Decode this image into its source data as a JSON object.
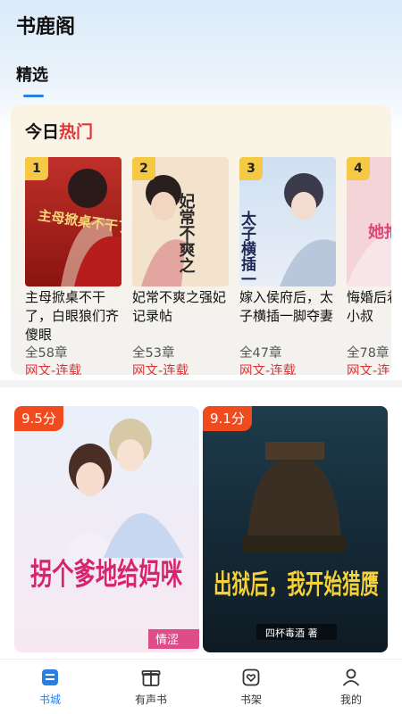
{
  "app": {
    "title": "书鹿阁"
  },
  "tabs": [
    {
      "label": "精选",
      "active": true
    }
  ],
  "hot": {
    "title_part1": "今日",
    "title_part2": "热门",
    "books": [
      {
        "rank": "1",
        "title": "主母掀桌不干了，白眼狼们齐傻眼",
        "chapters": "全58章",
        "category": "网文-连载",
        "cover_text": "主母掀桌不干了"
      },
      {
        "rank": "2",
        "title": "妃常不爽之强妃记录帖",
        "chapters": "全53章",
        "category": "网文-连载",
        "cover_text": "妃常不爽之"
      },
      {
        "rank": "3",
        "title": "嫁入侯府后，太子横插一脚夺妻",
        "chapters": "全47章",
        "category": "网文-连载",
        "cover_text": "太子横插一脚夺妻"
      },
      {
        "rank": "4",
        "title": "悔婚后着孕肚男小叔",
        "chapters": "全78章",
        "category": "网文-连载",
        "cover_text": "她抱渣男"
      }
    ]
  },
  "featured": [
    {
      "score": "9.5分",
      "cover_text": "拐个爹地给妈咪",
      "author_mark": "情涩"
    },
    {
      "score": "9.1分",
      "cover_text": "出狱后，我开始猎赝",
      "author_mark": "四杯毒酒 著"
    }
  ],
  "nav": [
    {
      "label": "书城",
      "icon": "bookstore-icon",
      "active": true
    },
    {
      "label": "有声书",
      "icon": "gift-box-icon",
      "active": false
    },
    {
      "label": "书架",
      "icon": "bookshelf-heart-icon",
      "active": false
    },
    {
      "label": "我的",
      "icon": "user-icon",
      "active": false
    }
  ],
  "colors": {
    "accent": "#2a7fe0",
    "hot_red": "#e0363a",
    "score_badge": "#f04b1f",
    "rank_badge": "#f6c945"
  }
}
